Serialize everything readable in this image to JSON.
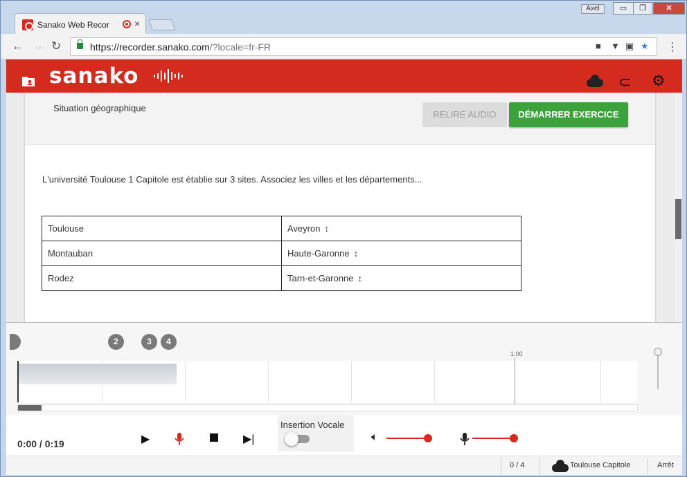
{
  "browser": {
    "tab_title": "Sanako Web Recorder",
    "tab_close": "×",
    "user_badge": "Axel",
    "url_host": "https://recorder.sanako.com",
    "url_rest": "/?locale=fr-FR",
    "window_min": "▭",
    "window_max": "❐",
    "window_close": "✕"
  },
  "app": {
    "logo": "sanako",
    "accent_color": "#d52b1e",
    "icons": [
      "folder-user-icon",
      "cloud-icon",
      "attachment-icon",
      "gear-icon"
    ]
  },
  "exercise": {
    "title": "Situation géographique",
    "review_button": "RELIRE AUDIO",
    "start_button": "DÉMARRER EXERCICE",
    "instructions": "L'université Toulouse 1 Capitole est établie sur 3 sites. Associez les villes et les départements...",
    "rows": [
      {
        "city": "Toulouse",
        "department": "Aveyron"
      },
      {
        "city": "Montauban",
        "department": "Haute-Garonne"
      },
      {
        "city": "Rodez",
        "department": "Tarn-et-Garonne"
      }
    ],
    "arrow": "↕"
  },
  "timeline": {
    "markers": [
      "2",
      "3",
      "4"
    ],
    "time_label": "1:00"
  },
  "controls": {
    "time": "0:00 / 0:19",
    "voice_insertion_label": "Insertion Vocale",
    "voice_insertion_on": false,
    "speaker_volume": 1.0,
    "mic_volume": 1.0
  },
  "status": {
    "progress": "0 / 4",
    "course": "Toulouse Capitole",
    "state": "Arrêt"
  }
}
